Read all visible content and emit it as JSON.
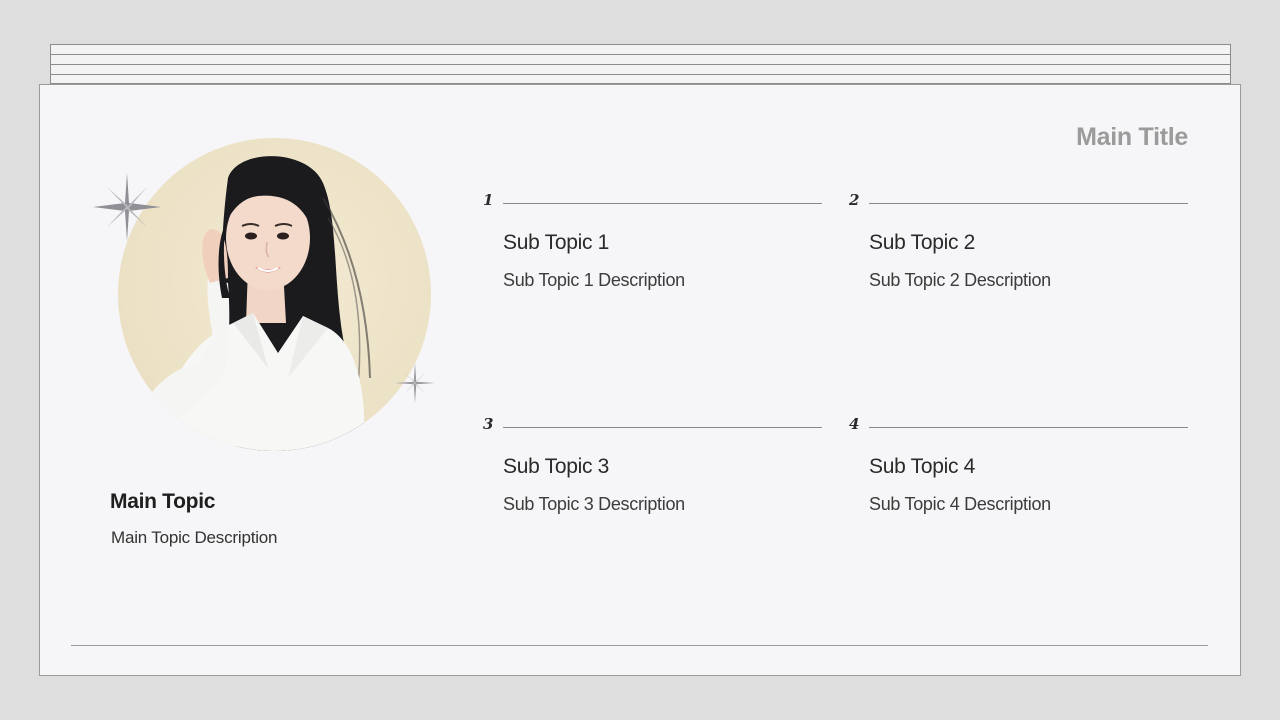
{
  "slide": {
    "main_title": "Main Title",
    "main_topic": {
      "title": "Main Topic",
      "description": "Main Topic Description"
    },
    "sub_topics": [
      {
        "number": "1",
        "title": "Sub Topic 1",
        "description": "Sub Topic 1 Description"
      },
      {
        "number": "2",
        "title": "Sub Topic 2",
        "description": "Sub Topic 2 Description"
      },
      {
        "number": "3",
        "title": "Sub Topic 3",
        "description": "Sub Topic 3 Description"
      },
      {
        "number": "4",
        "title": "Sub Topic 4",
        "description": "Sub Topic 4 Description"
      }
    ]
  },
  "colors": {
    "background": "#dedede",
    "slide_bg": "#f6f5f7",
    "title_gray": "#9b9b9b",
    "photo_circle_bg": "#ece2c6",
    "text_dark": "#2a2a2a"
  },
  "icons": [
    "sparkle-icon"
  ]
}
